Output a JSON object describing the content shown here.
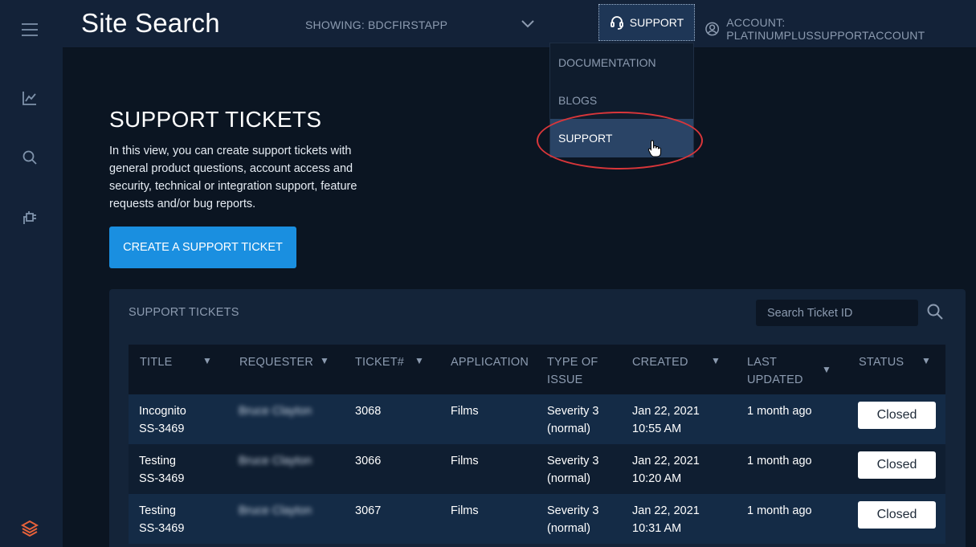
{
  "app": {
    "title": "Site Search"
  },
  "header": {
    "showing_label": "SHOWING: BDCFIRSTAPP",
    "support_label": "SUPPORT",
    "account_label": "ACCOUNT: PLATINUMPLUSSUPPORTACCOUNT"
  },
  "support_menu": {
    "items": [
      {
        "label": "DOCUMENTATION"
      },
      {
        "label": "BLOGS"
      },
      {
        "label": "SUPPORT"
      }
    ]
  },
  "sidebar": {
    "icons": [
      "menu-icon",
      "chart-icon",
      "search-icon",
      "plug-icon",
      "layers-logo-icon"
    ]
  },
  "main": {
    "title": "SUPPORT TICKETS",
    "description": "In this view, you can create support tickets with general product questions, account access and security, technical or integration support, feature requests and/or bug reports.",
    "create_button": "CREATE A SUPPORT TICKET"
  },
  "tickets_panel": {
    "title": "SUPPORT TICKETS",
    "search_placeholder": "Search Ticket ID",
    "columns": {
      "title": "TITLE",
      "requester": "REQUESTER",
      "ticket": "TICKET#",
      "application": "APPLICATION",
      "type_1": "TYPE OF",
      "type_2": "ISSUE",
      "created": "CREATED",
      "updated_1": "LAST",
      "updated_2": "UPDATED",
      "status": "STATUS"
    },
    "rows": [
      {
        "title_1": "Incognito",
        "title_2": "SS-3469",
        "requester": "Bruce Clayton",
        "ticket": "3068",
        "application": "Films",
        "type_1": "Severity 3",
        "type_2": "(normal)",
        "created_1": "Jan 22, 2021",
        "created_2": "10:55 AM",
        "updated": "1 month ago",
        "status": "Closed"
      },
      {
        "title_1": "Testing",
        "title_2": "SS-3469",
        "requester": "Bruce Clayton",
        "ticket": "3066",
        "application": "Films",
        "type_1": "Severity 3",
        "type_2": "(normal)",
        "created_1": "Jan 22, 2021",
        "created_2": "10:20 AM",
        "updated": "1 month ago",
        "status": "Closed"
      },
      {
        "title_1": "Testing",
        "title_2": "SS-3469",
        "requester": "Bruce Clayton",
        "ticket": "3067",
        "application": "Films",
        "type_1": "Severity 3",
        "type_2": "(normal)",
        "created_1": "Jan 22, 2021",
        "created_2": "10:31 AM",
        "updated": "1 month ago",
        "status": "Closed"
      }
    ]
  },
  "colors": {
    "accent": "#1a8fe0",
    "highlight_ring": "#d9363a",
    "logo": "#e8623a"
  }
}
